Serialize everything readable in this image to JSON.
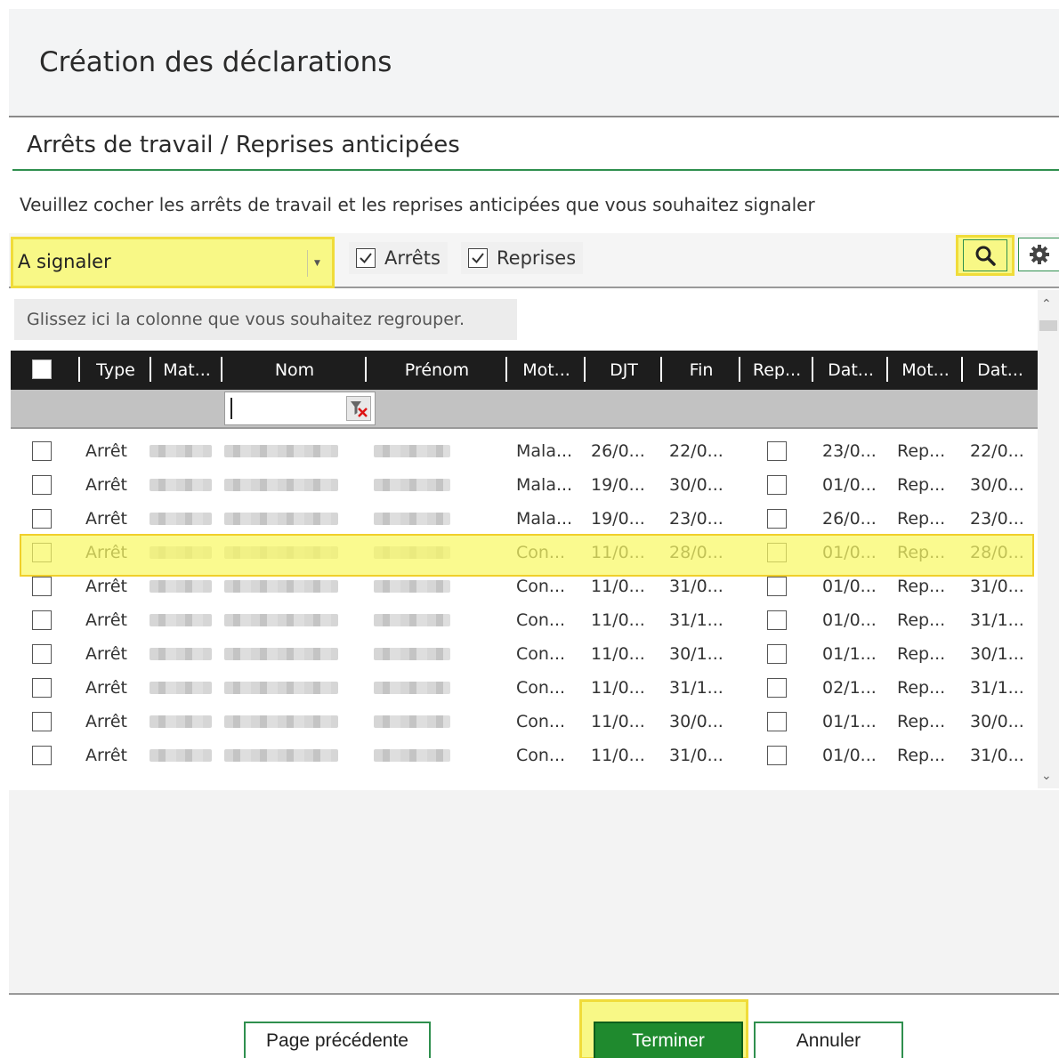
{
  "window": {
    "title": "Création des déclarations"
  },
  "section": {
    "title": "Arrêts de travail / Reprises anticipées",
    "instruction": "Veuillez cocher les arrêts de travail et les reprises anticipées que vous souhaitez signaler"
  },
  "toolbar": {
    "filter_value": "A signaler",
    "chk_arrets": {
      "label": "Arrêts",
      "checked": true
    },
    "chk_reprises": {
      "label": "Reprises",
      "checked": true
    }
  },
  "grid": {
    "group_hint": "Glissez ici la colonne que vous souhaitez regrouper.",
    "columns": [
      "Type",
      "Mat...",
      "Nom",
      "Prénom",
      "Mot...",
      "DJT",
      "Fin",
      "Rep...",
      "Dat...",
      "Mot...",
      "Dat..."
    ],
    "rows": [
      [
        "Arrêt",
        "Mala...",
        "26/0...",
        "22/0...",
        "23/0...",
        "Rep...",
        "22/0..."
      ],
      [
        "Arrêt",
        "Mala...",
        "19/0...",
        "30/0...",
        "01/0...",
        "Rep...",
        "30/0..."
      ],
      [
        "Arrêt",
        "Mala...",
        "19/0...",
        "23/0...",
        "26/0...",
        "Rep...",
        "23/0..."
      ],
      [
        "Arrêt",
        "Con...",
        "11/0...",
        "28/0...",
        "01/0...",
        "Rep...",
        "28/0..."
      ],
      [
        "Arrêt",
        "Con...",
        "11/0...",
        "31/0...",
        "01/0...",
        "Rep...",
        "31/0..."
      ],
      [
        "Arrêt",
        "Con...",
        "11/0...",
        "31/1...",
        "01/0...",
        "Rep...",
        "31/1..."
      ],
      [
        "Arrêt",
        "Con...",
        "11/0...",
        "30/1...",
        "01/1...",
        "Rep...",
        "30/1..."
      ],
      [
        "Arrêt",
        "Con...",
        "11/0...",
        "31/1...",
        "02/1...",
        "Rep...",
        "31/1..."
      ],
      [
        "Arrêt",
        "Con...",
        "11/0...",
        "30/0...",
        "01/1...",
        "Rep...",
        "30/0..."
      ],
      [
        "Arrêt",
        "Con...",
        "11/0...",
        "31/0...",
        "01/0...",
        "Rep...",
        "31/0..."
      ]
    ],
    "highlighted_row": 3
  },
  "footer": {
    "prev_label": "Page précédente",
    "finish_label": "Terminer",
    "cancel_label": "Annuler"
  },
  "colors": {
    "accent_green": "#2f8f4e",
    "finish_green": "#1f8a2e",
    "highlight_yellow": "#f8f886",
    "header_dark": "#1d1d1d"
  }
}
